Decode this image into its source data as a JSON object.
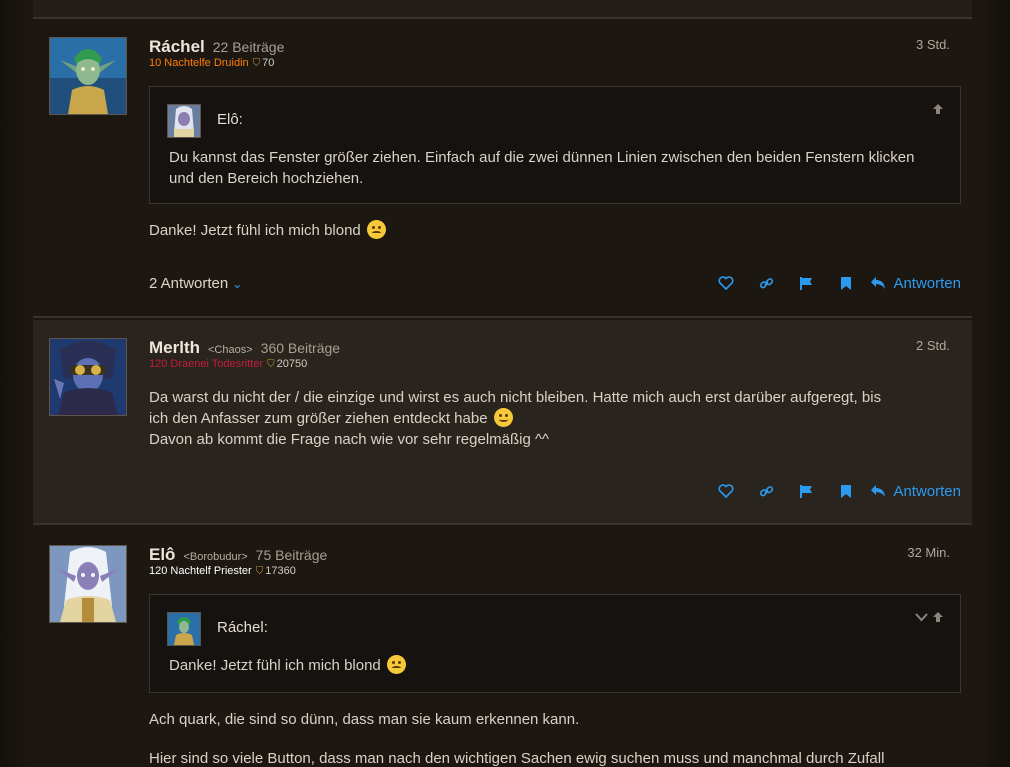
{
  "posts": [
    {
      "author": "Ráchel",
      "guild": "",
      "post_count": "22 Beiträge",
      "char_info": "10 Nachtelfe Druidin",
      "char_color": "#ff7d0a",
      "achievement_points": "70",
      "time": "3 Std.",
      "quote": {
        "author": "Elô:",
        "text": "Du kannst das Fenster größer ziehen. Einfach auf die zwei dünnen Linien zwischen den beiden Fenstern klicken und den Bereich hochziehen."
      },
      "body": "Danke! Jetzt fühl ich mich blond",
      "replies_label": "2 Antworten",
      "reply_label": "Antworten"
    },
    {
      "author": "Merlth",
      "guild": "<Chaos>",
      "post_count": "360 Beiträge",
      "char_info": "120 Draenei Todesritter",
      "char_color": "#c41e3a",
      "achievement_points": "20750",
      "time": "2 Std.",
      "body_line1": "Da warst du nicht der / die einzige und wirst es auch nicht bleiben. Hatte mich auch erst darüber aufgeregt, bis",
      "body_line2": "ich den Anfasser zum größer ziehen entdeckt habe",
      "body_line3": "Davon ab kommt die Frage nach wie vor sehr regelmäßig ^^",
      "reply_label": "Antworten"
    },
    {
      "author": "Elô",
      "guild": "<Borobudur>",
      "post_count": "75 Beiträge",
      "char_info": "120 Nachtelf Priester",
      "char_color": "#ffffff",
      "achievement_points": "17360",
      "time": "32 Min.",
      "quote": {
        "author": "Ráchel:",
        "text": "Danke! Jetzt fühl ich mich blond"
      },
      "body_para1": "Ach quark, die sind so dünn, dass man sie kaum erkennen kann.",
      "body_para2": "Hier sind so viele Button, dass man nach den wichtigen Sachen ewig suchen muss und manchmal durch Zufall"
    }
  ],
  "icons": {
    "like": "heart-icon",
    "share": "link-icon",
    "report": "flag-icon",
    "bookmark": "bookmark-icon",
    "reply": "reply-arrow-icon",
    "expand": "chevron-down-icon",
    "collapse": "arrow-up-icon"
  },
  "colors": {
    "accent": "#2b9bef",
    "background": "#1d1712"
  }
}
